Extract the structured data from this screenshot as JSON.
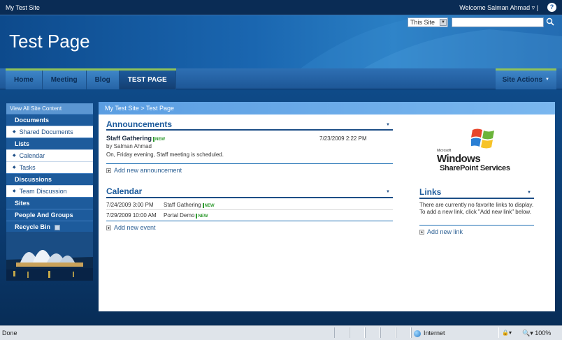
{
  "topbar": {
    "site_name": "My Test Site",
    "welcome": "Welcome Salman Ahmad ▿ |",
    "help_icon": "?"
  },
  "header": {
    "title": "Test Page",
    "search_scope": "This Site",
    "search_go_icon": "search-go-icon"
  },
  "nav": {
    "tabs": [
      "Home",
      "Meeting",
      "Blog",
      "TEST PAGE"
    ],
    "active_tab": "TEST PAGE",
    "site_actions": "Site Actions"
  },
  "leftnav": {
    "view_all": "View All Site Content",
    "documents": "Documents",
    "shared_documents": "Shared Documents",
    "lists": "Lists",
    "calendar": "Calendar",
    "tasks": "Tasks",
    "discussions": "Discussions",
    "team_discussion": "Team Discussion",
    "sites": "Sites",
    "people_and_groups": "People And Groups",
    "recycle_bin": "Recycle Bin"
  },
  "breadcrumb": "My Test Site > Test Page",
  "announcements": {
    "title": "Announcements",
    "item_title": "Staff Gathering",
    "new_label": "NEW",
    "date": "7/23/2009 2:22 PM",
    "by": "by Salman Ahmad",
    "body": "On, Friday evening, Staff meeting is scheduled.",
    "add_new": "Add new announcement"
  },
  "calendar": {
    "title": "Calendar",
    "events": [
      {
        "date": "7/24/2009 3:00 PM",
        "title": "Staff Gathering"
      },
      {
        "date": "7/29/2009 10:00 AM",
        "title": "Portal Demo"
      }
    ],
    "new_label": "NEW",
    "add_new": "Add new event"
  },
  "logo": {
    "microsoft": "Microsoft",
    "windows": "Windows",
    "sharepoint": "SharePoint Services"
  },
  "links": {
    "title": "Links",
    "empty_text": "There are currently no favorite links to display. To add a new link, click \"Add new link\" below.",
    "add_new": "Add new link"
  },
  "statusbar": {
    "done": "Done",
    "zone": "Internet",
    "zoom": "100%"
  },
  "colors": {
    "brand_blue": "#1d5b9c",
    "accent_green": "#8fc25a",
    "new_green": "#2f9a2f"
  }
}
